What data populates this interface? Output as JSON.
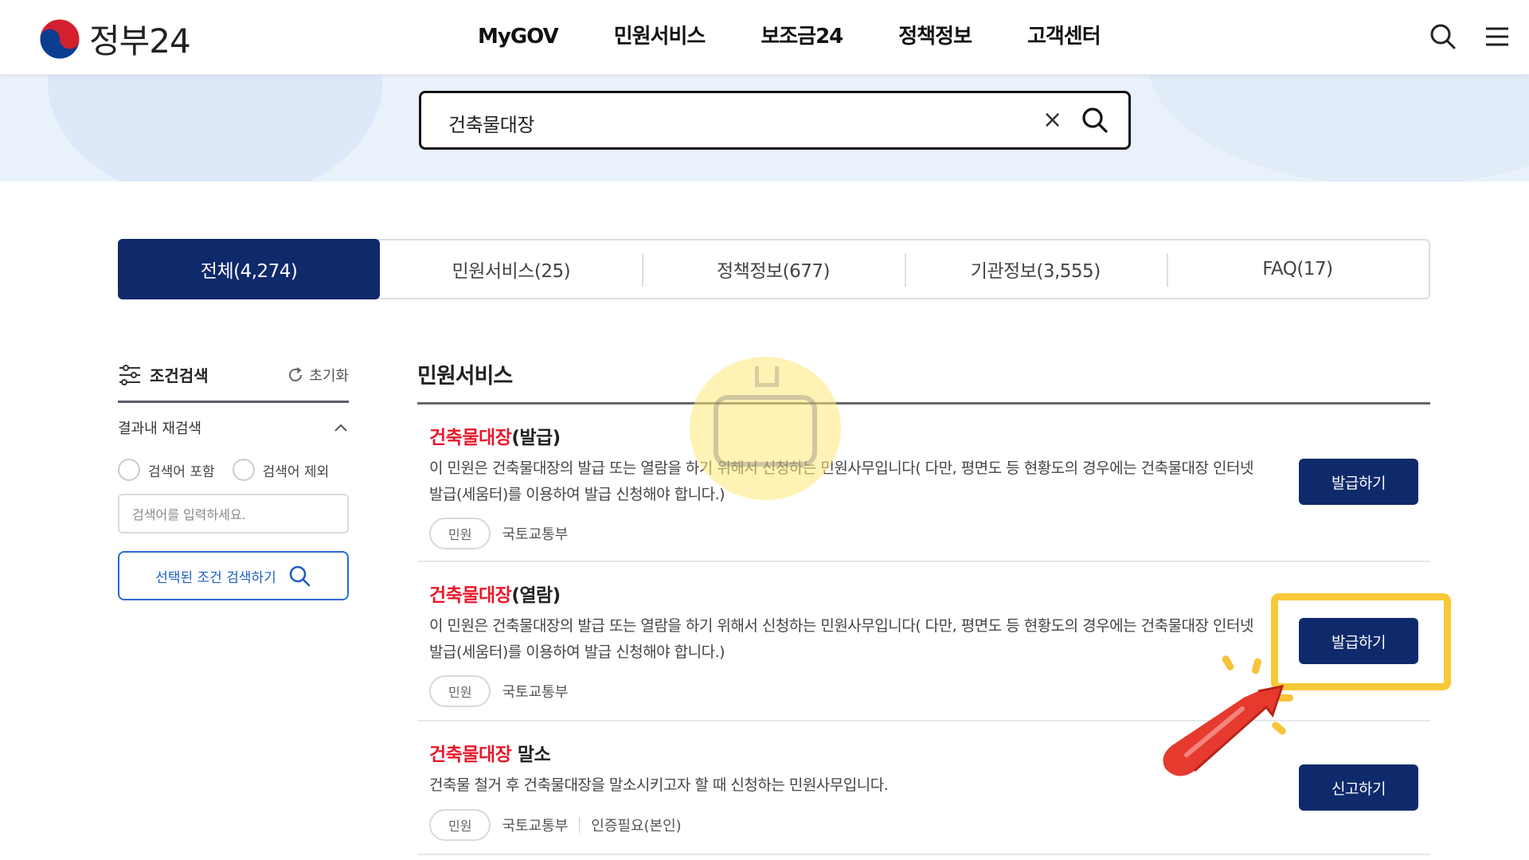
{
  "header": {
    "logo_text": "정부24",
    "nav": [
      "MyGOV",
      "민원서비스",
      "보조금24",
      "정책정보",
      "고객센터"
    ]
  },
  "search": {
    "value": "건축물대장",
    "clear_label": "×"
  },
  "tabs": [
    {
      "label": "전체(4,274)",
      "active": true
    },
    {
      "label": "민원서비스(25)",
      "active": false
    },
    {
      "label": "정책정보(677)",
      "active": false
    },
    {
      "label": "기관정보(3,555)",
      "active": false
    },
    {
      "label": "FAQ(17)",
      "active": false
    }
  ],
  "sidebar": {
    "filter_title": "조건검색",
    "reset_label": "초기화",
    "subsearch_title": "결과내 재검색",
    "radio_include": "검색어 포함",
    "radio_exclude": "검색어 제외",
    "input_placeholder": "검색어를 입력하세요.",
    "search_button": "선택된 조건 검색하기"
  },
  "results": {
    "section_title": "민원서비스",
    "items": [
      {
        "title_highlight": "건축물대장",
        "title_rest": "(발급)",
        "desc": "이 민원은 건축물대장의 발급 또는 열람을 하기 위해서 신청하는 민원사무입니다( 다만, 평면도 등 현황도의 경우에는 건축물대장 인터넷발급(세움터)를 이용하여 발급 신청해야 합니다.)",
        "tag": "민원",
        "agency": "국토교통부",
        "button": "발급하기"
      },
      {
        "title_highlight": "건축물대장",
        "title_rest": "(열람)",
        "desc": "이 민원은 건축물대장의 발급 또는 열람을 하기 위해서 신청하는 민원사무입니다( 다만, 평면도 등 현황도의 경우에는 건축물대장 인터넷발급(세움터)를 이용하여 발급 신청해야 합니다.)",
        "tag": "민원",
        "agency": "국토교통부",
        "button": "발급하기"
      },
      {
        "title_highlight": "건축물대장",
        "title_rest": " 말소",
        "desc": "건축물 철거 후 건축물대장을 말소시키고자 할 때 신청하는 민원사무입니다.",
        "tag": "민원",
        "agency": "국토교통부",
        "auth": "인증필요(본인)",
        "button": "신고하기"
      }
    ]
  },
  "colors": {
    "brand_navy": "#0f2a6b",
    "highlight_red": "#e8192c",
    "annotation_yellow": "#f9c838",
    "band_bg": "#e9f1fb"
  },
  "icons": {
    "search": "search-icon",
    "menu": "hamburger-menu-icon",
    "filter": "sliders-icon",
    "reset": "refresh-icon",
    "collapse": "chevron-up-icon"
  }
}
